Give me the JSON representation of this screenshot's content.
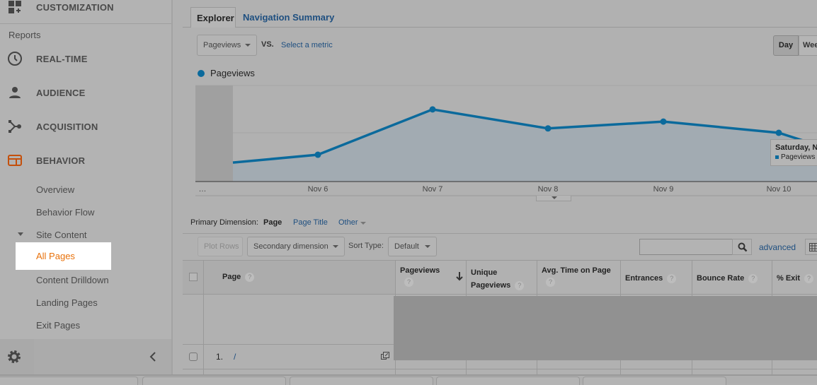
{
  "sidebar": {
    "customization": "CUSTOMIZATION",
    "reports_heading": "Reports",
    "items": [
      {
        "label": "REAL-TIME",
        "icon": "clock-icon"
      },
      {
        "label": "AUDIENCE",
        "icon": "person-icon"
      },
      {
        "label": "ACQUISITION",
        "icon": "acquisition-icon"
      },
      {
        "label": "BEHAVIOR",
        "icon": "behavior-icon"
      }
    ],
    "behavior_sub": [
      "Overview",
      "Behavior Flow"
    ],
    "site_content": "Site Content",
    "site_content_items": [
      "All Pages",
      "Content Drilldown",
      "Landing Pages",
      "Exit Pages"
    ],
    "active_item": "All Pages",
    "active_color": "#e8710a"
  },
  "tabs": {
    "explorer": "Explorer",
    "navigation_summary": "Navigation Summary"
  },
  "metric": {
    "selected": "Pageviews",
    "vs": "VS.",
    "select_metric": "Select a metric"
  },
  "granularity": {
    "day": "Day",
    "week": "Wee"
  },
  "legend": {
    "label": "Pageviews",
    "color": "#0b6a9c"
  },
  "tooltip": {
    "title": "Saturday, N",
    "series": "Pageviews"
  },
  "chart_data": {
    "type": "area",
    "categories": [
      "…",
      "Nov 6",
      "Nov 7",
      "Nov 8",
      "Nov 9",
      "Nov 10"
    ],
    "series": [
      {
        "name": "Pageviews",
        "values": [
          0.39,
          0.55,
          1.48,
          1.09,
          1.23,
          1.0,
          0.75
        ]
      }
    ],
    "ylim": [
      0,
      2
    ],
    "grid": true,
    "legend": "top-left"
  },
  "dimension": {
    "label": "Primary Dimension:",
    "page": "Page",
    "page_title": "Page Title",
    "other": "Other"
  },
  "toolbar": {
    "plot_rows": "Plot Rows",
    "secondary": "Secondary dimension",
    "sort_type": "Sort Type:",
    "sort_value": "Default",
    "search_placeholder": "",
    "advanced": "advanced"
  },
  "table": {
    "headers": {
      "page": "Page",
      "pageviews": "Pageviews",
      "unique1": "Unique",
      "unique2": "Pageviews",
      "avg_time": "Avg. Time on Page",
      "entrances": "Entrances",
      "bounce": "Bounce Rate",
      "exit": "% Exit"
    },
    "rows": [
      {
        "index": "1.",
        "page": "/"
      }
    ]
  }
}
